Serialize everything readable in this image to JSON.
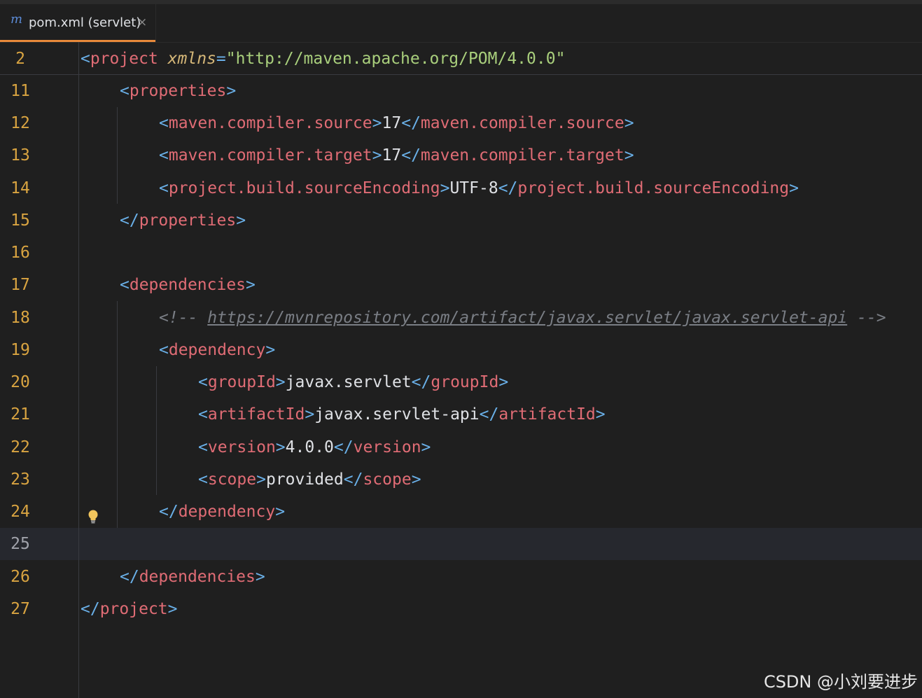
{
  "tab": {
    "icon": "maven-m-icon",
    "icon_glyph": "m",
    "title": "pom.xml (servlet)",
    "close_glyph": "×"
  },
  "lines": [
    {
      "num": "2",
      "tokens": [
        [
          "b",
          "<"
        ],
        [
          "t",
          "project"
        ],
        [
          "txt",
          " "
        ],
        [
          "a",
          "xmlns"
        ],
        [
          "b",
          "="
        ],
        [
          "v",
          "\"http://maven.apache.org/POM/4.0.0\""
        ]
      ]
    },
    {
      "num": "11",
      "tokens": [
        [
          "b",
          "<"
        ],
        [
          "t",
          "properties"
        ],
        [
          "b",
          ">"
        ]
      ]
    },
    {
      "num": "12",
      "tokens": [
        [
          "b",
          "<"
        ],
        [
          "t",
          "maven.compiler.source"
        ],
        [
          "b",
          ">"
        ],
        [
          "txt",
          "17"
        ],
        [
          "b",
          "</"
        ],
        [
          "t",
          "maven.compiler.source"
        ],
        [
          "b",
          ">"
        ]
      ]
    },
    {
      "num": "13",
      "tokens": [
        [
          "b",
          "<"
        ],
        [
          "t",
          "maven.compiler.target"
        ],
        [
          "b",
          ">"
        ],
        [
          "txt",
          "17"
        ],
        [
          "b",
          "</"
        ],
        [
          "t",
          "maven.compiler.target"
        ],
        [
          "b",
          ">"
        ]
      ]
    },
    {
      "num": "14",
      "tokens": [
        [
          "b",
          "<"
        ],
        [
          "t",
          "project.build.sourceEncoding"
        ],
        [
          "b",
          ">"
        ],
        [
          "txt",
          "UTF-8"
        ],
        [
          "b",
          "</"
        ],
        [
          "t",
          "project.build.sourceEncoding"
        ],
        [
          "b",
          ">"
        ]
      ]
    },
    {
      "num": "15",
      "tokens": [
        [
          "b",
          "</"
        ],
        [
          "t",
          "properties"
        ],
        [
          "b",
          ">"
        ]
      ]
    },
    {
      "num": "16",
      "tokens": []
    },
    {
      "num": "17",
      "tokens": [
        [
          "b",
          "<"
        ],
        [
          "t",
          "dependencies"
        ],
        [
          "b",
          ">"
        ]
      ]
    },
    {
      "num": "18",
      "tokens": [
        [
          "c",
          "<!-- "
        ],
        [
          "cu",
          "https://mvnrepository.com/artifact/javax.servlet/javax.servlet-api"
        ],
        [
          "c",
          " -->"
        ]
      ]
    },
    {
      "num": "19",
      "tokens": [
        [
          "b",
          "<"
        ],
        [
          "t",
          "dependency"
        ],
        [
          "b",
          ">"
        ]
      ]
    },
    {
      "num": "20",
      "tokens": [
        [
          "b",
          "<"
        ],
        [
          "t",
          "groupId"
        ],
        [
          "b",
          ">"
        ],
        [
          "txt",
          "javax.servlet"
        ],
        [
          "b",
          "</"
        ],
        [
          "t",
          "groupId"
        ],
        [
          "b",
          ">"
        ]
      ]
    },
    {
      "num": "21",
      "tokens": [
        [
          "b",
          "<"
        ],
        [
          "t",
          "artifactId"
        ],
        [
          "b",
          ">"
        ],
        [
          "txt",
          "javax.servlet-api"
        ],
        [
          "b",
          "</"
        ],
        [
          "t",
          "artifactId"
        ],
        [
          "b",
          ">"
        ]
      ]
    },
    {
      "num": "22",
      "tokens": [
        [
          "b",
          "<"
        ],
        [
          "t",
          "version"
        ],
        [
          "b",
          ">"
        ],
        [
          "txt",
          "4.0.0"
        ],
        [
          "b",
          "</"
        ],
        [
          "t",
          "version"
        ],
        [
          "b",
          ">"
        ]
      ]
    },
    {
      "num": "23",
      "tokens": [
        [
          "b",
          "<"
        ],
        [
          "t",
          "scope"
        ],
        [
          "b",
          ">"
        ],
        [
          "txt",
          "provided"
        ],
        [
          "b",
          "</"
        ],
        [
          "t",
          "scope"
        ],
        [
          "b",
          ">"
        ]
      ]
    },
    {
      "num": "24",
      "tokens": [
        [
          "b",
          "</"
        ],
        [
          "t",
          "dependency"
        ],
        [
          "b",
          ">"
        ]
      ]
    },
    {
      "num": "25",
      "tokens": []
    },
    {
      "num": "26",
      "tokens": [
        [
          "b",
          "</"
        ],
        [
          "t",
          "dependencies"
        ],
        [
          "b",
          ">"
        ]
      ]
    },
    {
      "num": "27",
      "tokens": [
        [
          "b",
          "</"
        ],
        [
          "t",
          "project"
        ],
        [
          "b",
          ">"
        ]
      ]
    }
  ],
  "current_line": "25",
  "intention_icon": "lightbulb-icon",
  "watermark": "CSDN @小刘要进步",
  "colors": {
    "background": "#1f1f1f",
    "tab_underline": "#e8893a",
    "line_number": "#d9a441",
    "tag_name": "#e06c75",
    "bracket": "#6ab0e8",
    "attribute": "#d5b778",
    "attribute_value": "#a9cf7c",
    "comment": "#7a7e85"
  }
}
